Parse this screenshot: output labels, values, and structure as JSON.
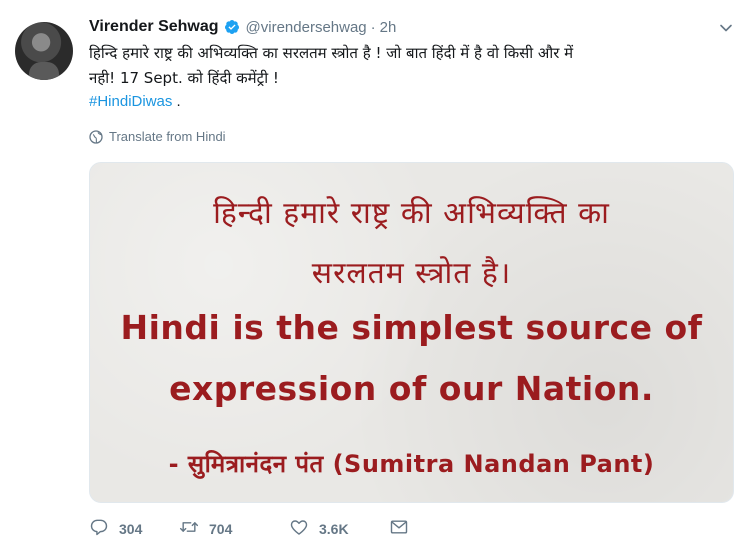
{
  "author": {
    "name": "Virender Sehwag",
    "handle": "@virendersehwag",
    "separator": "·",
    "time": "2h"
  },
  "tweet": {
    "line1": "हिन्दि हमारे राष्ट्र की अभिव्यक्ति का सरलतम स्त्रोत है ! जो बात हिंदी में है वो किसी और में",
    "line2": "नही! 17 Sept. को हिंदी कमेंट्री !",
    "hashtag": "#HindiDiwas",
    "hashtag_suffix": " ."
  },
  "translate_label": "Translate from Hindi",
  "media": {
    "hindi_line1": "हिन्दी हमारे राष्ट्र की अभिव्यक्ति का",
    "hindi_line2": "सरलतम स्त्रोत है।",
    "english_line1": "Hindi is the simplest source of",
    "english_line2": "expression of our Nation.",
    "attribution": "- सुमित्रानंदन पंत (Sumitra Nandan Pant)"
  },
  "actions": {
    "replies": "304",
    "retweets": "704",
    "likes": "3.6K"
  },
  "colors": {
    "accent": "#1b95e0",
    "verified": "#1da1f2",
    "quote_text": "#9b1c1f",
    "muted": "#657786"
  }
}
